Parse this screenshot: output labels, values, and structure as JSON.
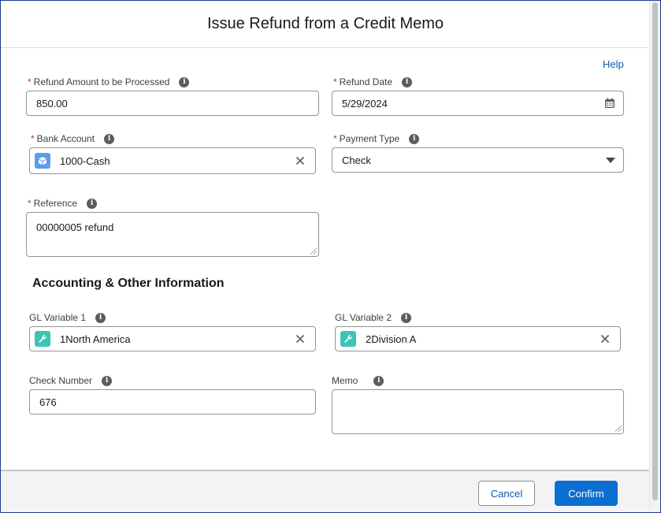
{
  "modal": {
    "title": "Issue Refund from a Credit Memo",
    "help_label": "Help"
  },
  "fields": {
    "refund_amount": {
      "label": "Refund Amount to be Processed",
      "required": "*",
      "value": "850.00"
    },
    "refund_date": {
      "label": "Refund Date",
      "required": "*",
      "value": "5/29/2024"
    },
    "bank_account": {
      "label": "Bank Account",
      "required": "*",
      "value": "1000-Cash"
    },
    "payment_type": {
      "label": "Payment Type",
      "required": "*",
      "value": "Check"
    },
    "reference": {
      "label": "Reference",
      "required": "*",
      "value": "00000005 refund"
    }
  },
  "accounting": {
    "heading": "Accounting & Other Information",
    "gl_variable_1": {
      "label": "GL Variable 1",
      "value": "1North America"
    },
    "gl_variable_2": {
      "label": "GL Variable 2",
      "value": "2Division A"
    },
    "check_number": {
      "label": "Check Number",
      "value": "676"
    },
    "memo": {
      "label": "Memo",
      "value": ""
    }
  },
  "footer": {
    "cancel_label": "Cancel",
    "confirm_label": "Confirm"
  },
  "icons": {
    "info": "info-icon",
    "calendar": "calendar-icon",
    "bank": "bank-account-icon",
    "gl": "wrench-icon",
    "clear": "clear-icon",
    "dropdown": "chevron-down-icon"
  },
  "colors": {
    "brand": "#0b6fd1",
    "link": "#0b5cab",
    "required": "#c23934",
    "lookup_blue": "#5b9ee8",
    "lookup_teal": "#3cc4b5"
  }
}
